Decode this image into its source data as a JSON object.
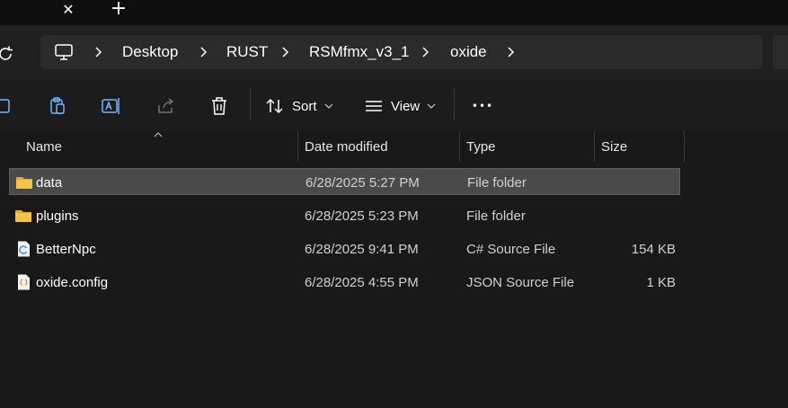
{
  "window": {
    "tab_close_glyph": "✕",
    "new_tab_glyph": "+"
  },
  "address": {
    "segments": [
      "Desktop",
      "RUST",
      "RSMfmx_v3_1",
      "oxide"
    ]
  },
  "toolbar": {
    "sort_label": "Sort",
    "view_label": "View",
    "more_glyph": "•••"
  },
  "columns": {
    "name": "Name",
    "date": "Date modified",
    "type": "Type",
    "size": "Size"
  },
  "files": [
    {
      "name": "data",
      "date": "6/28/2025 5:27 PM",
      "type": "File folder",
      "size": "",
      "icon": "folder-icon",
      "selected": true
    },
    {
      "name": "plugins",
      "date": "6/28/2025 5:23 PM",
      "type": "File folder",
      "size": "",
      "icon": "folder-icon",
      "selected": false
    },
    {
      "name": "BetterNpc",
      "date": "6/28/2025 9:41 PM",
      "type": "C# Source File",
      "size": "154 KB",
      "icon": "csharp-file-icon",
      "selected": false
    },
    {
      "name": "oxide.config",
      "date": "6/28/2025 4:55 PM",
      "type": "JSON Source File",
      "size": "1 KB",
      "icon": "json-file-icon",
      "selected": false
    }
  ],
  "colors": {
    "background": "#191919",
    "selected_row": "#4a4a4a",
    "folder": "#f5c443",
    "text": "#ffffff"
  }
}
